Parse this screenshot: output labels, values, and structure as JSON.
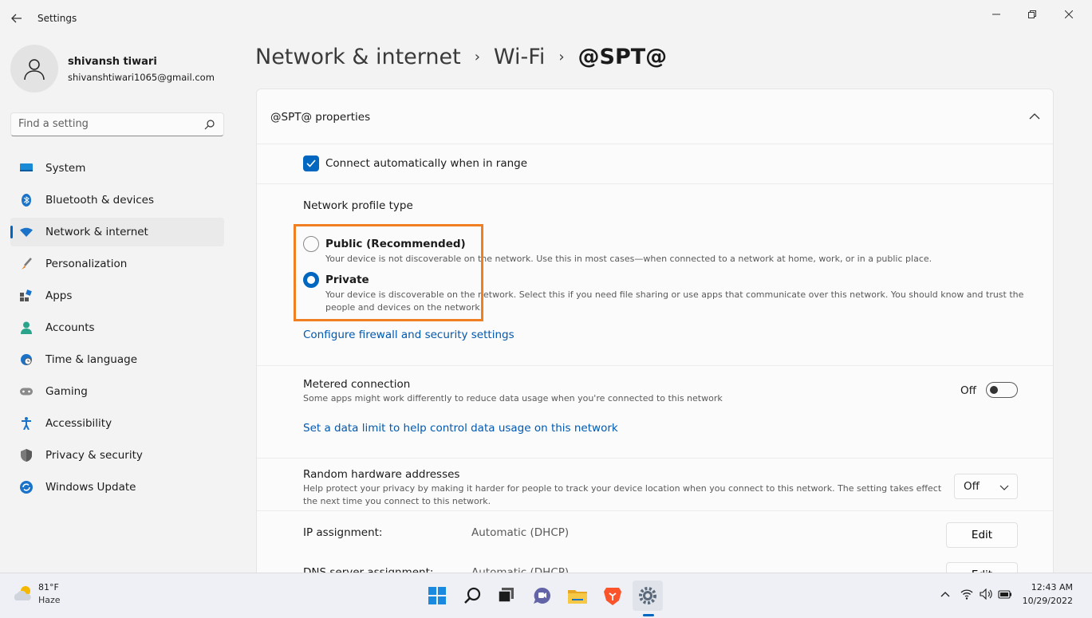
{
  "window": {
    "app_title": "Settings"
  },
  "profile": {
    "name": "shivansh tiwari",
    "email": "shivanshtiwari1065@gmail.com"
  },
  "search": {
    "placeholder": "Find a setting"
  },
  "sidebar": {
    "items": [
      {
        "label": "System",
        "icon": "system-icon",
        "active": false
      },
      {
        "label": "Bluetooth & devices",
        "icon": "bluetooth-icon",
        "active": false
      },
      {
        "label": "Network & internet",
        "icon": "wifi-icon",
        "active": true
      },
      {
        "label": "Personalization",
        "icon": "brush-icon",
        "active": false
      },
      {
        "label": "Apps",
        "icon": "apps-icon",
        "active": false
      },
      {
        "label": "Accounts",
        "icon": "person-icon",
        "active": false
      },
      {
        "label": "Time & language",
        "icon": "globe-clock-icon",
        "active": false
      },
      {
        "label": "Gaming",
        "icon": "gamepad-icon",
        "active": false
      },
      {
        "label": "Accessibility",
        "icon": "accessibility-icon",
        "active": false
      },
      {
        "label": "Privacy & security",
        "icon": "shield-icon",
        "active": false
      },
      {
        "label": "Windows Update",
        "icon": "update-icon",
        "active": false
      }
    ]
  },
  "breadcrumb": {
    "level1": "Network & internet",
    "level2": "Wi-Fi",
    "current": "@SPT@"
  },
  "properties": {
    "title": "@SPT@ properties",
    "connect_auto": {
      "label": "Connect automatically when in range",
      "checked": true
    },
    "profile_type": {
      "heading": "Network profile type",
      "options": [
        {
          "label": "Public (Recommended)",
          "description": "Your device is not discoverable on the network. Use this in most cases—when connected to a network at home, work, or in a public place.",
          "selected": false
        },
        {
          "label": "Private",
          "description_line1": "Your device is discoverable on the network. Select this if you need file sharing or use apps that communicate over this network. You should know and trust the",
          "description_line2": "people and devices on the network.",
          "selected": true
        }
      ],
      "firewall_link": "Configure firewall and security settings"
    },
    "metered": {
      "title": "Metered connection",
      "description": "Some apps might work differently to reduce data usage when you're connected to this network",
      "state": "Off",
      "data_limit_link": "Set a data limit to help control data usage on this network"
    },
    "random_hw": {
      "title": "Random hardware addresses",
      "description_line1": "Help protect your privacy by making it harder for people to track your device location when you connect to this network. The setting takes effect",
      "description_line2": "the next time you connect to this network.",
      "value": "Off"
    },
    "ip_assignment": {
      "label": "IP assignment:",
      "value": "Automatic (DHCP)",
      "button": "Edit"
    },
    "dns_assignment": {
      "label": "DNS server assignment:",
      "value": "Automatic (DHCP)",
      "button": "Edit"
    }
  },
  "taskbar": {
    "weather_temp": "81°F",
    "weather_desc": "Haze",
    "apps": [
      "windows-start-icon",
      "search-icon",
      "task-view-icon",
      "teams-chat-icon",
      "file-explorer-icon",
      "brave-browser-icon",
      "settings-gear-icon"
    ],
    "time": "12:43 AM",
    "date": "10/29/2022"
  },
  "colors": {
    "accent": "#0067c0",
    "highlight": "#f07f23",
    "link": "#0058b0"
  }
}
